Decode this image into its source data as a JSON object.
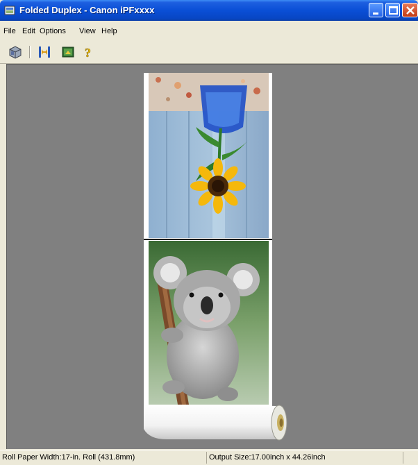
{
  "window": {
    "title": "Folded Duplex - Canon iPFxxxx"
  },
  "menu": {
    "items": [
      "File",
      "Edit",
      "Options",
      "View",
      "Help"
    ]
  },
  "toolbar": {
    "icons": [
      "printer-settings-icon",
      "page-layout-icon",
      "preview-image-icon",
      "help-icon"
    ]
  },
  "preview": {
    "page1_subject": "sunflower-vase",
    "page2_subject": "koala"
  },
  "status": {
    "roll_paper": "Roll Paper Width:17-in. Roll (431.8mm)",
    "output_size": "Output Size:17.00inch x 44.26inch"
  }
}
